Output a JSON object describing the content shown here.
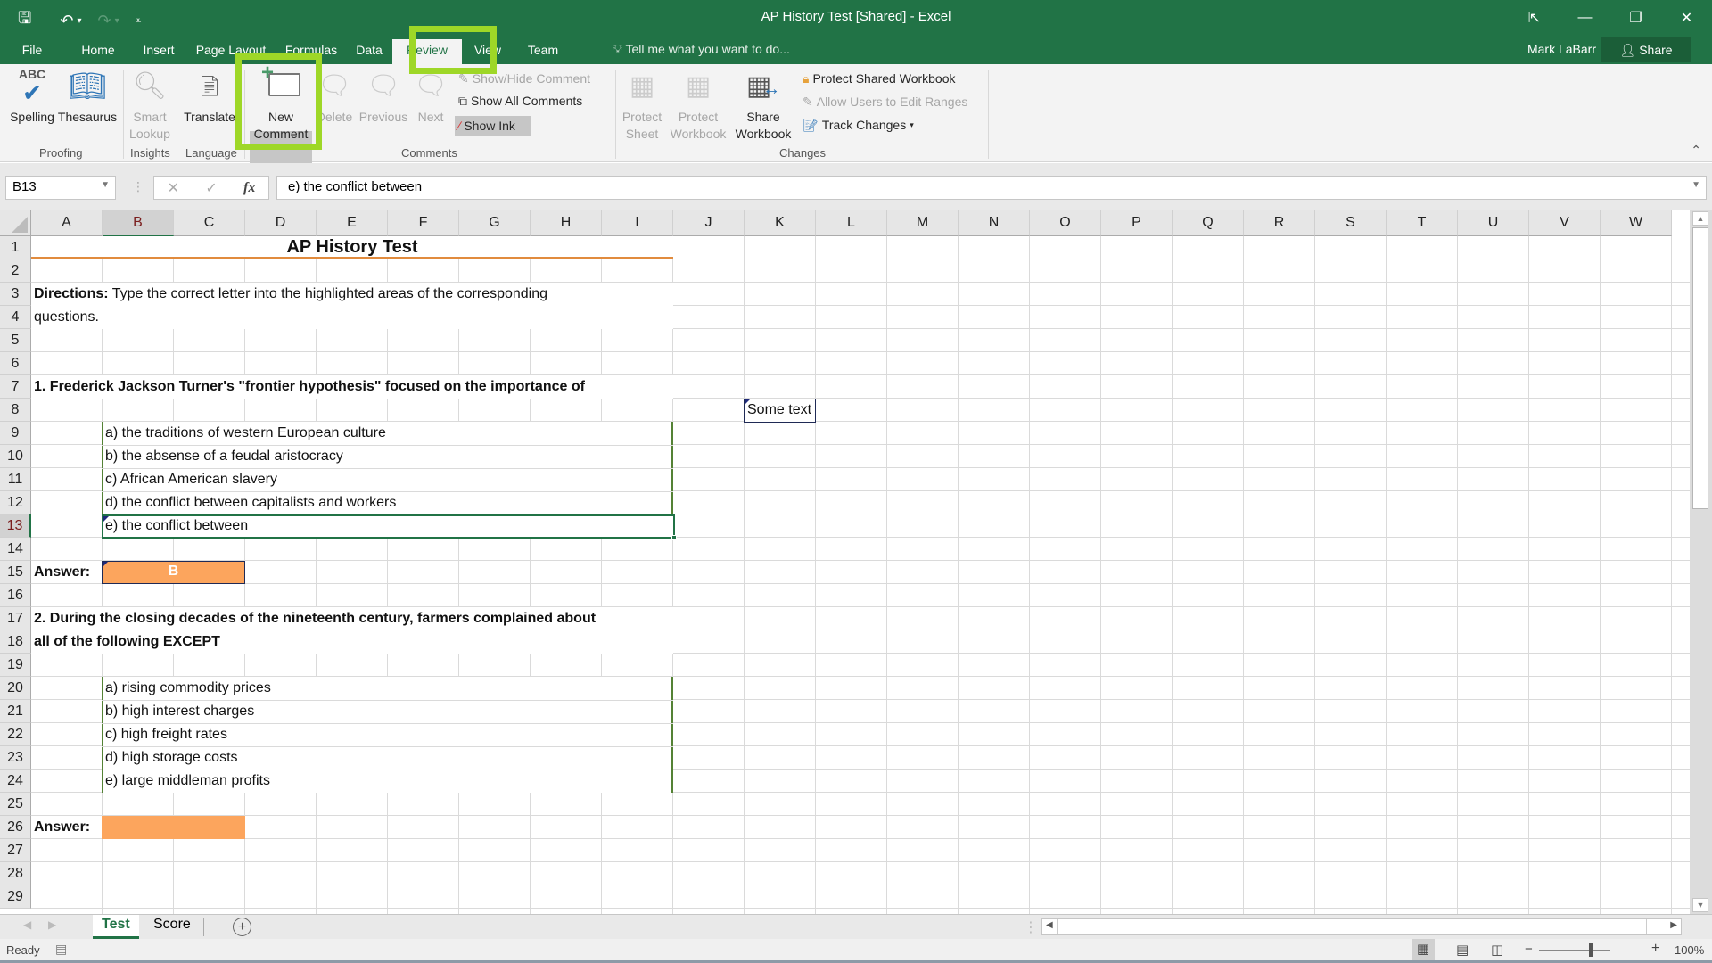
{
  "window": {
    "title": "AP History Test  [Shared] - Excel",
    "controls": {
      "ribbon_display": "⇱",
      "minimize": "—",
      "restore": "❐",
      "close": "✕"
    }
  },
  "qat": {
    "save": "🖫",
    "undo": "↶",
    "undo_dd": "▾",
    "redo": "↷",
    "redo_dd": "▾",
    "customize": "⩡"
  },
  "ribbon_tabs": [
    {
      "label": "File"
    },
    {
      "label": "Home"
    },
    {
      "label": "Insert"
    },
    {
      "label": "Page Layout"
    },
    {
      "label": "Formulas"
    },
    {
      "label": "Data"
    },
    {
      "label": "Review",
      "active": true
    },
    {
      "label": "View"
    },
    {
      "label": "Team"
    }
  ],
  "tell_me": {
    "icon": "lightbulb-icon",
    "text": "Tell me what you want to do..."
  },
  "user": {
    "name": "Mark LaBarr",
    "share_label": "Share"
  },
  "ribbon": {
    "groups": {
      "proofing": "Proofing",
      "insights": "Insights",
      "language": "Language",
      "comments": "Comments",
      "changes": "Changes"
    },
    "buttons": {
      "spelling": "Spelling",
      "thesaurus": "Thesaurus",
      "smart_lookup_1": "Smart",
      "smart_lookup_2": "Lookup",
      "translate": "Translate",
      "new_comment_1": "New",
      "new_comment_2": "Comment",
      "delete": "Delete",
      "previous": "Previous",
      "next": "Next",
      "show_hide_comment": "Show/Hide Comment",
      "show_all_comments": "Show All Comments",
      "show_ink": "Show Ink",
      "protect_sheet_1": "Protect",
      "protect_sheet_2": "Sheet",
      "protect_workbook_1": "Protect",
      "protect_workbook_2": "Workbook",
      "share_workbook_1": "Share",
      "share_workbook_2": "Workbook",
      "protect_shared_workbook": "Protect Shared Workbook",
      "allow_users_edit_ranges": "Allow Users to Edit Ranges",
      "track_changes": "Track Changes",
      "collapse": "⌃"
    }
  },
  "formula_bar": {
    "name_box": "B13",
    "cancel": "✕",
    "enter": "✓",
    "fx": "fx",
    "value": "e) the conflict between"
  },
  "sheet": {
    "columns": [
      "A",
      "B",
      "C",
      "D",
      "E",
      "F",
      "G",
      "H",
      "I",
      "J",
      "K",
      "L",
      "M",
      "N",
      "O",
      "P",
      "Q",
      "R",
      "S",
      "T",
      "U",
      "V",
      "W"
    ],
    "selected_column": "B",
    "rows": [
      "1",
      "2",
      "3",
      "4",
      "5",
      "6",
      "7",
      "8",
      "9",
      "10",
      "11",
      "12",
      "13",
      "14",
      "15",
      "16",
      "17",
      "18",
      "19",
      "20",
      "21",
      "22",
      "23",
      "24",
      "25",
      "26",
      "27",
      "28",
      "29"
    ],
    "selected_row": "13",
    "title": "AP History Test",
    "directions_label": "Directions:",
    "directions_text": " Type the correct letter into the highlighted areas of the corresponding",
    "directions_text2": "questions.",
    "q1": {
      "question": "1. Frederick Jackson Turner's \"frontier hypothesis\" focused on the importance of",
      "options": [
        "a) the traditions of western European culture",
        "b) the absense of a feudal aristocracy",
        "c) African American slavery",
        "d) the conflict between capitalists and workers",
        "e) the conflict between"
      ],
      "answer_label": "Answer:",
      "answer_value": "B"
    },
    "q2": {
      "question_line1": "2. During the closing decades of the nineteenth century, farmers complained about",
      "question_line2": "all of the following EXCEPT",
      "options": [
        "a) rising commodity prices",
        "b) high interest charges",
        "c) high freight rates",
        "d) high storage costs",
        "e) large middleman profits"
      ],
      "answer_label": "Answer:",
      "answer_value": ""
    },
    "k8_text": "Some text"
  },
  "sheet_tabs": [
    {
      "label": "Test",
      "active": true
    },
    {
      "label": "Score"
    }
  ],
  "add_sheet": "+",
  "status": {
    "ready": "Ready",
    "zoom": "100%",
    "zoom_level_percent": 100,
    "zoom_minus": "−",
    "zoom_plus": "+"
  },
  "colors": {
    "excel_green": "#217346",
    "answer_fill": "#fca55d",
    "title_underline": "#e18b3d",
    "highlight": "#9ed727"
  }
}
